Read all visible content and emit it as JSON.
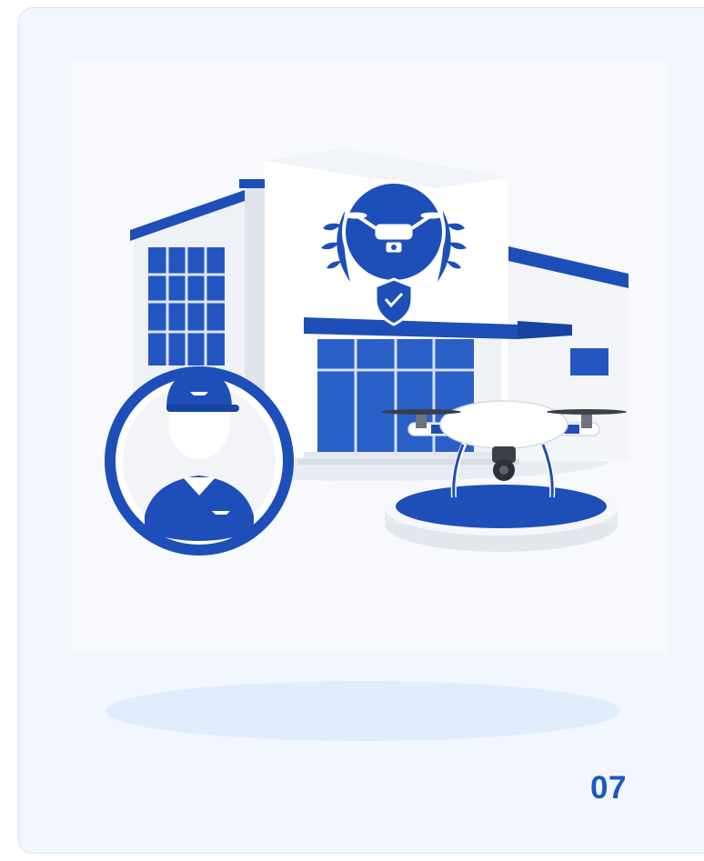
{
  "card": {
    "step_number": "07"
  },
  "colors": {
    "primary_blue": "#1e4fb8",
    "card_background": "#f2f7fe",
    "number_color": "#1a57c3"
  },
  "illustration": {
    "icons": [
      "building-icon",
      "drone-emblem-icon",
      "shield-check-icon",
      "pilot-avatar-icon",
      "drone-icon",
      "platform-icon",
      "wings-badge-icon"
    ]
  }
}
